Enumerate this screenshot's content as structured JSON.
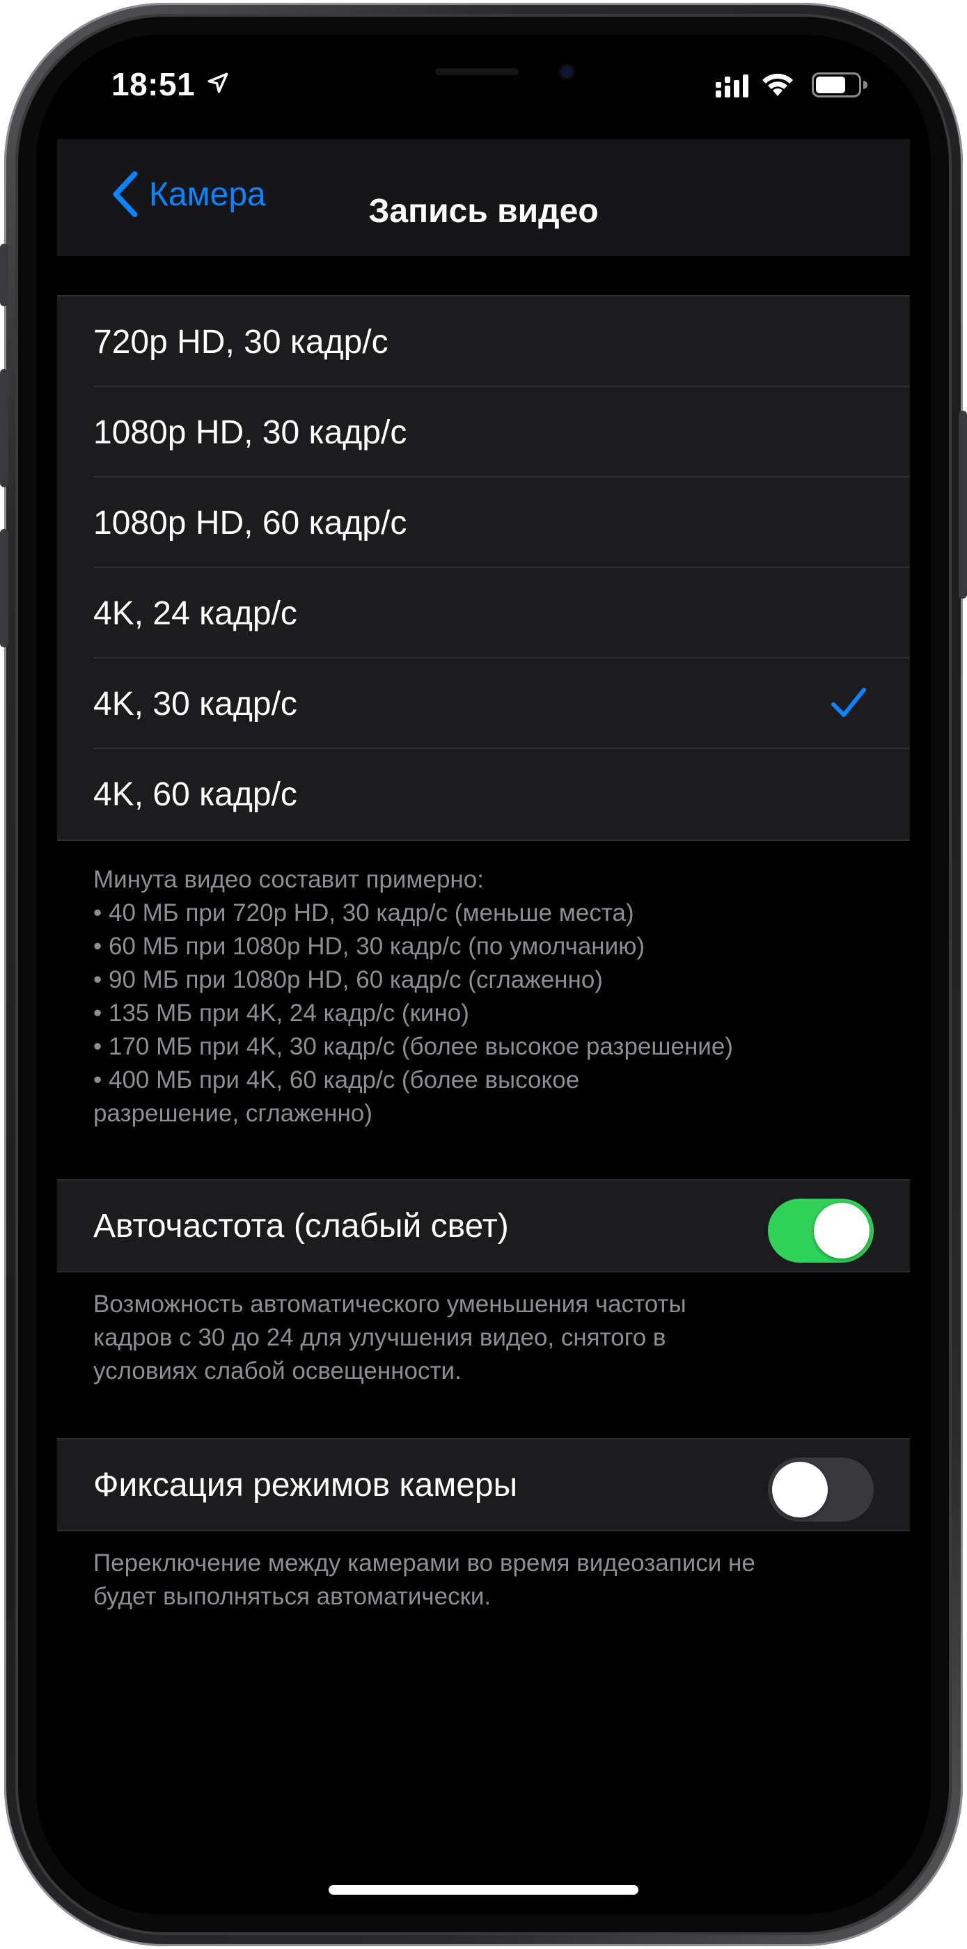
{
  "status_bar": {
    "time": "18:51",
    "location_icon": "location-arrow-icon",
    "signal_icon": "cellular-signal-icon",
    "wifi_icon": "wifi-icon",
    "battery_icon": "battery-icon"
  },
  "navbar": {
    "back_label": "Камера",
    "title": "Запись видео"
  },
  "formats": {
    "items": [
      {
        "label": "720p HD, 30 кадр/с",
        "selected": false
      },
      {
        "label": "1080p HD, 30 кадр/с",
        "selected": false
      },
      {
        "label": "1080p HD, 60 кадр/с",
        "selected": false
      },
      {
        "label": "4K, 24 кадр/с",
        "selected": false
      },
      {
        "label": "4K, 30 кадр/с",
        "selected": true
      },
      {
        "label": "4K, 60 кадр/с",
        "selected": false
      }
    ],
    "note_lines": [
      "Минута видео составит примерно:",
      "• 40 МБ при 720p HD, 30 кадр/с (меньше места)",
      "• 60 МБ при 1080p HD, 30 кадр/с (по умолчанию)",
      "• 90 МБ при 1080p HD, 60 кадр/с (сглаженно)",
      "• 135 МБ при 4K, 24 кадр/с (кино)",
      "• 170 МБ при 4K, 30 кадр/с (более высокое разрешение)",
      "• 400 МБ при 4K, 60 кадр/с (более высокое",
      "разрешение, сглаженно)"
    ]
  },
  "auto_fps": {
    "label": "Авточастота (слабый свет)",
    "enabled": true,
    "note_lines": [
      "Возможность автоматического уменьшения частоты",
      "кадров с 30 до 24 для улучшения видео, снятого в",
      "условиях слабой освещенности."
    ]
  },
  "lock_camera": {
    "label": "Фиксация режимов камеры",
    "enabled": false,
    "note_lines": [
      "Переключение между камерами во время видеозаписи не",
      "будет выполняться автоматически."
    ]
  },
  "colors": {
    "accent": "#0a84ff",
    "toggle_on": "#30d158",
    "toggle_off": "#39393d",
    "group_bg": "#1c1c1e",
    "note_text": "#8d8d93"
  }
}
